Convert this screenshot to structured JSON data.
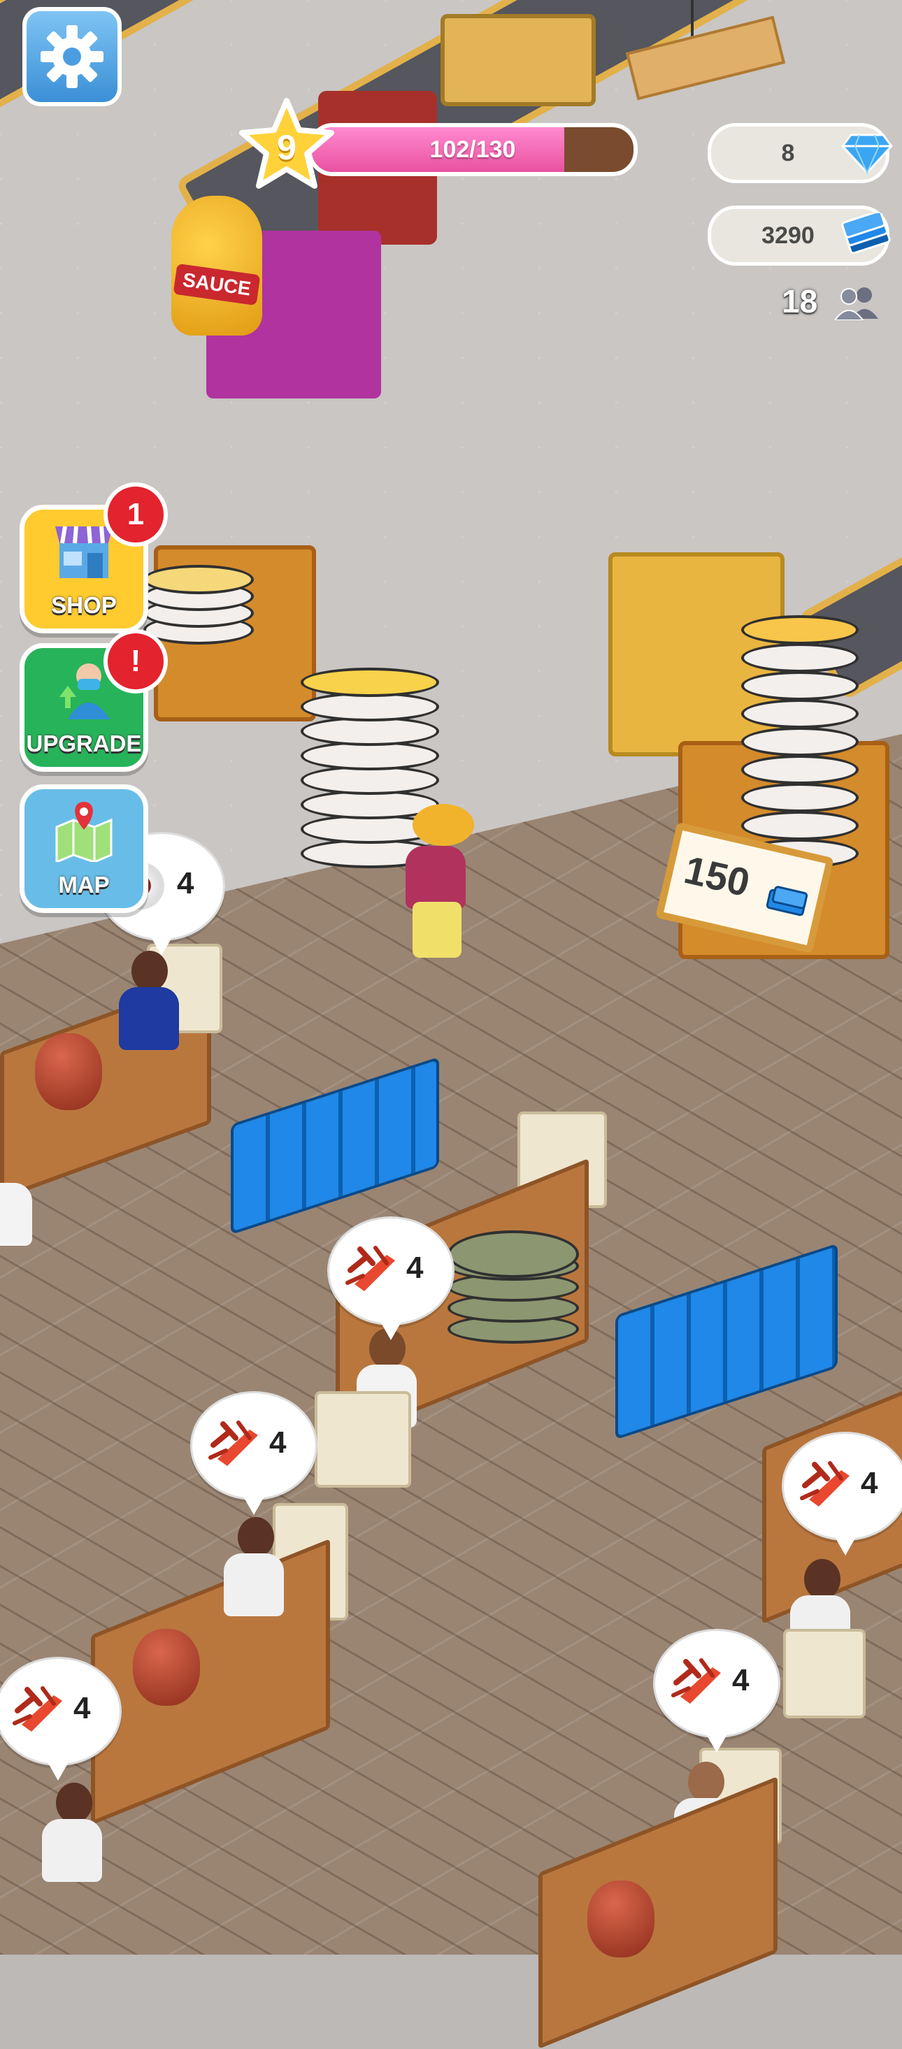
{
  "hud": {
    "level": "9",
    "xp_text": "102/130",
    "xp_fraction": 0.785,
    "gems": "8",
    "cash": "3290",
    "customers": "18"
  },
  "side_buttons": {
    "shop_label": "SHOP",
    "shop_badge": "1",
    "upgrade_label": "UPGRADE",
    "upgrade_badge": "!",
    "map_label": "MAP"
  },
  "world": {
    "sauce_label": "SAUCE",
    "price": "150"
  },
  "orders": [
    {
      "item": "food-icon",
      "count": "4"
    },
    {
      "item": "lobster-icon",
      "count": "4"
    },
    {
      "item": "lobster-icon",
      "count": "4"
    },
    {
      "item": "lobster-icon",
      "count": "4"
    },
    {
      "item": "lobster-icon",
      "count": "4"
    },
    {
      "item": "lobster-icon",
      "count": "4"
    }
  ],
  "colors": {
    "gem": "#3aa6f2",
    "cash": "#1f88e8",
    "xp_fill": "#e9519f",
    "badge": "#e3232d",
    "shop": "#ffcb2f",
    "upgrade": "#27b35a",
    "map": "#68bde8"
  }
}
